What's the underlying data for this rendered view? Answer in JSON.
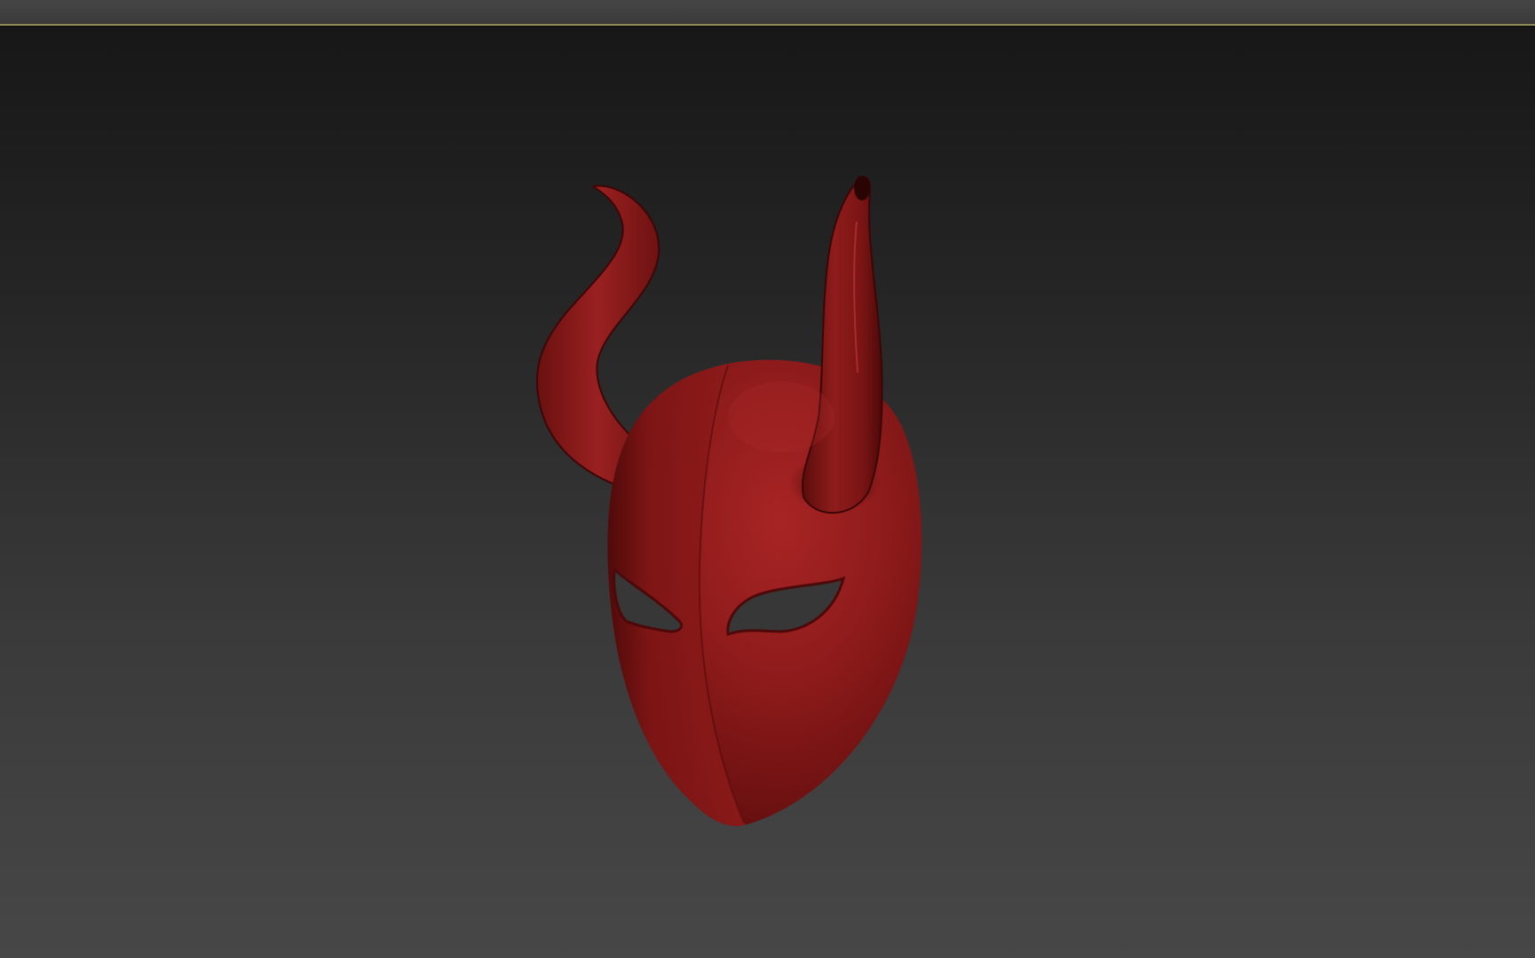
{
  "window": {
    "title": "",
    "viewport_label": ""
  },
  "viewport": {
    "background_top": "#171717",
    "background_bottom": "#474747",
    "active_border_color": "#8c8a55"
  },
  "model": {
    "name": "devil mask",
    "material_color": "#8a1a1a",
    "highlight_color": "#b32828",
    "shadow_color": "#3e0606"
  }
}
